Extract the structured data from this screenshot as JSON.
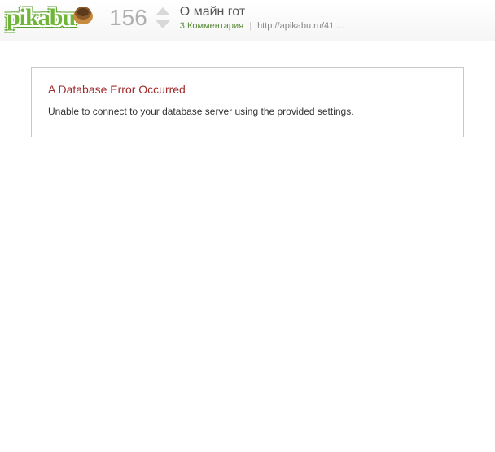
{
  "header": {
    "logo_text": "pikabu",
    "vote_count": "156",
    "post_title": "О майн гот",
    "comments_text": "3 Комментария",
    "url_text": "http://apikabu.ru/41 ..."
  },
  "error": {
    "title": "A Database Error Occurred",
    "message": "Unable to connect to your database server using the provided settings."
  }
}
